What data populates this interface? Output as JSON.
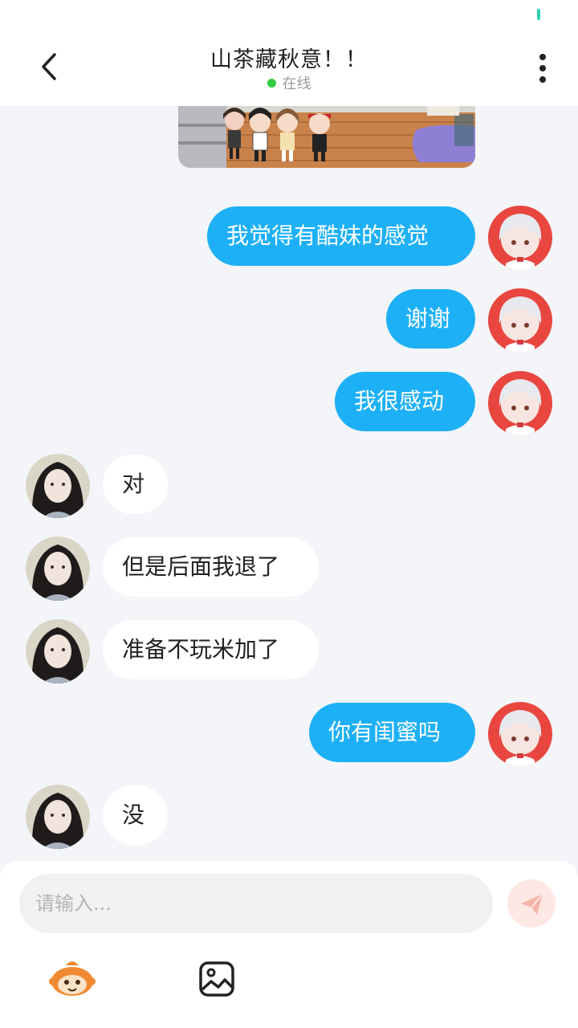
{
  "header": {
    "title": "山茶藏秋意！！",
    "status": "在线"
  },
  "messages": [
    {
      "from": "me",
      "text": "我觉得有酷妹的感觉"
    },
    {
      "from": "me",
      "text": "谢谢"
    },
    {
      "from": "me",
      "text": "我很感动"
    },
    {
      "from": "other",
      "text": "对"
    },
    {
      "from": "other",
      "text": "但是后面我退了"
    },
    {
      "from": "other",
      "text": "准备不玩米加了"
    },
    {
      "from": "me",
      "text": "你有闺蜜吗"
    },
    {
      "from": "other",
      "text": "没"
    }
  ],
  "composer": {
    "placeholder": "请输入..."
  },
  "colors": {
    "my_bubble": "#1db0f6",
    "other_bubble": "#ffffff",
    "online": "#33cc44",
    "background": "#f3f5f8"
  },
  "icons": [
    "back-arrow-icon",
    "more-vertical-icon",
    "send-icon",
    "emoji-mascot-icon",
    "image-icon"
  ]
}
